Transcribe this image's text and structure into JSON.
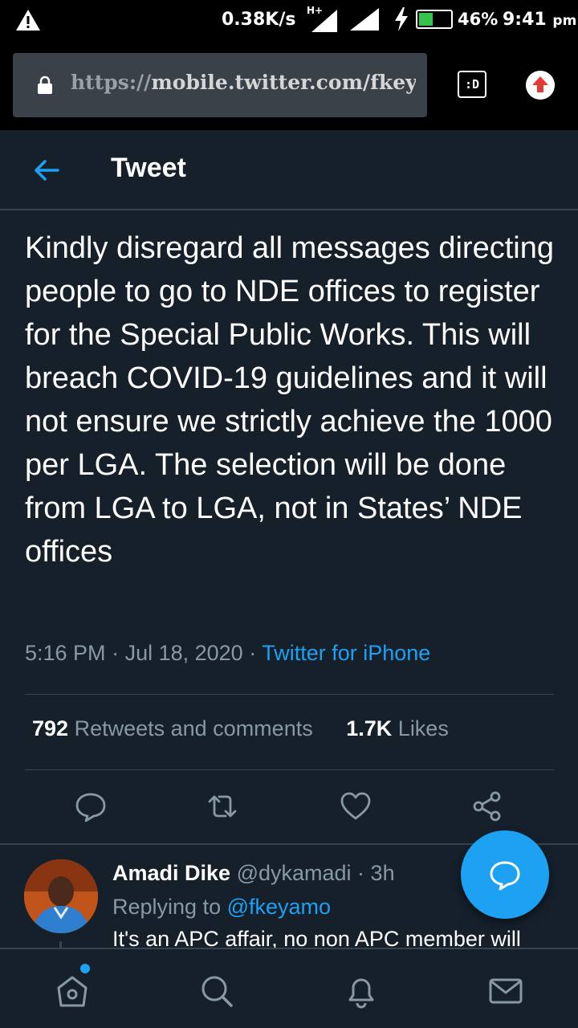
{
  "status_bar": {
    "network_speed": "0.38K/s",
    "network_type": "H+",
    "battery_percent": "46%",
    "battery_level": 0.46,
    "time": "9:41",
    "ampm": "pm"
  },
  "browser": {
    "url_protocol": "https://",
    "url_rest": "mobile.twitter.com/fkeyamo",
    "tabs_label": ":D"
  },
  "header": {
    "title": "Tweet"
  },
  "tweet": {
    "text": "Kindly disregard all messages directing people to go to NDE offices to register for the Special Public Works. This will breach COVID-19 guidelines and it will not ensure we strictly achieve the 1000 per LGA. The selection will be done from LGA to LGA, not in States’ NDE offices",
    "time": "5:16 PM",
    "date": "Jul 18, 2020",
    "source": "Twitter for iPhone",
    "retweets_count": "792",
    "retweets_label": "Retweets and comments",
    "likes_count": "1.7K",
    "likes_label": "Likes"
  },
  "reply": {
    "name": "Amadi Dike",
    "handle": "@dykamadi",
    "time": "3h",
    "replying_prefix": "Replying to",
    "replying_to": "@fkeyamo",
    "text": "It's an APC affair,  no non APC member will"
  },
  "icons": {
    "back": "arrow-left-icon",
    "reply": "comment-icon",
    "retweet": "retweet-icon",
    "like": "heart-icon",
    "share": "share-icon",
    "compose": "compose-reply-icon",
    "home": "home-icon",
    "search": "search-icon",
    "notifications": "bell-icon",
    "messages": "mail-icon"
  },
  "colors": {
    "background": "#15202b",
    "accent": "#1da1f2",
    "secondary_text": "#8899a6",
    "border": "#38444d"
  }
}
